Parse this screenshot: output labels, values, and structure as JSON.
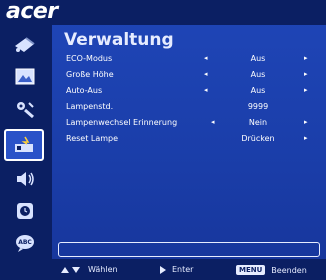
{
  "brand": "acer",
  "title": "Verwaltung",
  "settings": [
    {
      "label": "ECO-Modus",
      "value": "Aus",
      "left_arrow": "◂",
      "right_arrow": "▸"
    },
    {
      "label": "Große Höhe",
      "value": "Aus",
      "left_arrow": "◂",
      "right_arrow": "▸"
    },
    {
      "label": "Auto-Aus",
      "value": "Aus",
      "left_arrow": "◂",
      "right_arrow": "▸"
    },
    {
      "label": "Lampenstd.",
      "value": "9999",
      "left_arrow": "",
      "right_arrow": ""
    },
    {
      "label": "Lampenwechsel Erinnerung",
      "value": "Nein",
      "left_arrow": "◂",
      "right_arrow": "▸"
    },
    {
      "label": "Reset Lampe",
      "value": "Drücken",
      "left_arrow": "",
      "right_arrow": "▸"
    }
  ],
  "sidebar": [
    {
      "icon": "color-adjust-icon"
    },
    {
      "icon": "image-icon"
    },
    {
      "icon": "settings-tools-icon"
    },
    {
      "icon": "management-icon"
    },
    {
      "icon": "audio-icon"
    },
    {
      "icon": "timer-icon"
    },
    {
      "icon": "language-icon"
    }
  ],
  "footer": {
    "select_label": "Wählen",
    "enter_label": "Enter",
    "menu_key": "MENU",
    "exit_label": "Beenden"
  },
  "colors": {
    "background": "#1a3da8",
    "bar": "#0b1f63",
    "text": "#ffffff"
  }
}
